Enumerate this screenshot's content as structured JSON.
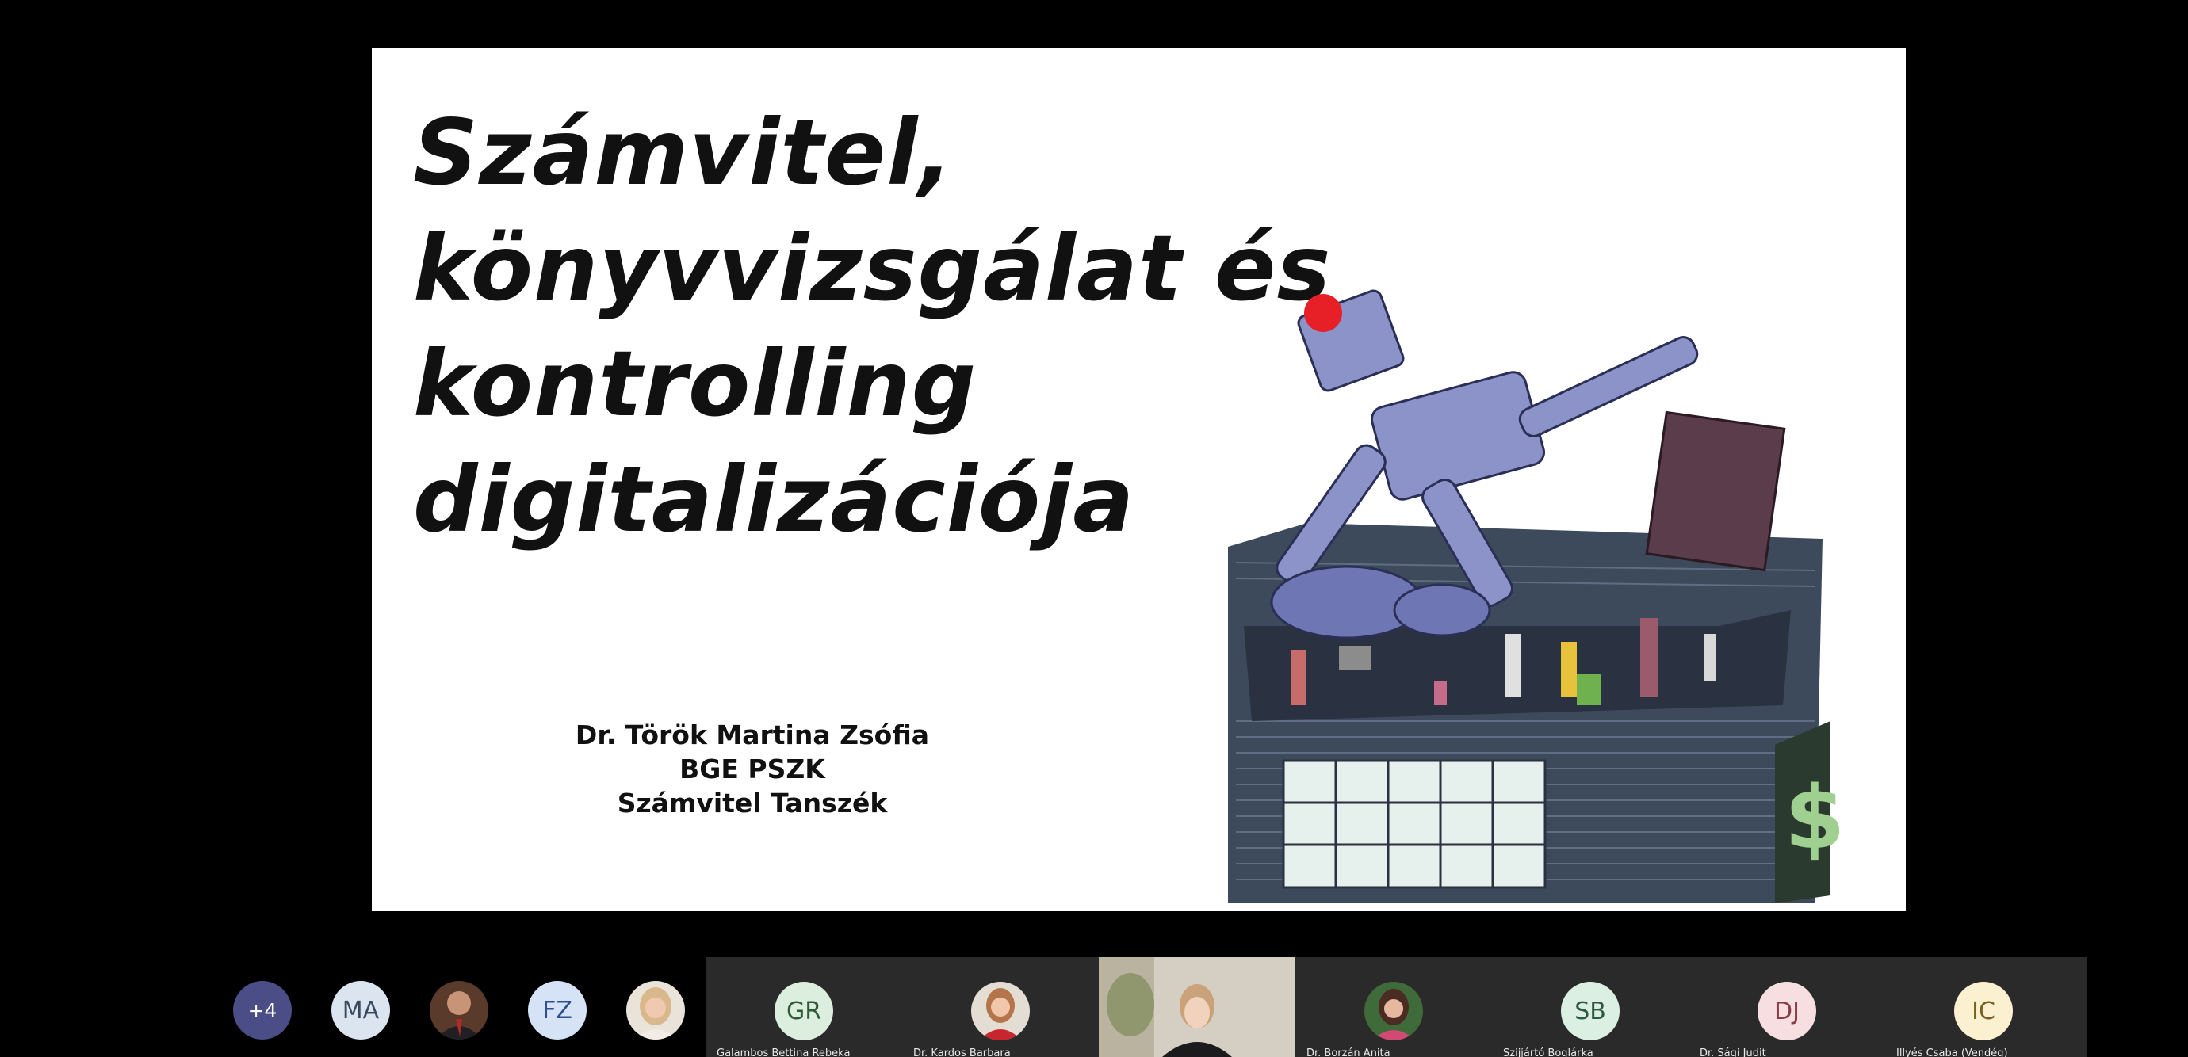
{
  "slide": {
    "title_lines": [
      "Számvitel,",
      "könyvvizsgálat és",
      "kontrolling",
      "digitalizációja"
    ],
    "presenter": {
      "name": "Dr. Török Martina Zsófia",
      "org": "BGE PSZK",
      "dept": "Számvitel Tanszék"
    },
    "illustration": "robot-office-illustration"
  },
  "participants": {
    "strip": [
      {
        "label": "+4",
        "bg": "#4b4d86",
        "fg": "#ffffff"
      },
      {
        "label": "MA",
        "bg": "#dbe5f0",
        "fg": "#3a4a5e"
      },
      {
        "label": "",
        "photo": "man-photo-avatar"
      },
      {
        "label": "FZ",
        "bg": "#d6e3f7",
        "fg": "#2f4f8f"
      },
      {
        "label": "",
        "photo": "woman-photo-avatar"
      }
    ],
    "tiles": [
      {
        "initials": "GR",
        "name": "Galambos Bettina Rebeka",
        "bg": "#dcefdf",
        "fg": "#2e5a36"
      },
      {
        "initials": "",
        "name": "Dr. Kardos Barbara",
        "photo": "woman-red-photo-avatar"
      },
      {
        "initials": "",
        "name": "",
        "video": "webcam-video-feed"
      },
      {
        "initials": "",
        "name": "Dr. Borzán Anita",
        "photo": "woman-dark-photo-avatar"
      },
      {
        "initials": "SB",
        "name": "Szijjártó Boglárka",
        "bg": "#dcefe3",
        "fg": "#2e5a40"
      },
      {
        "initials": "DJ",
        "name": "Dr. Sági Judit",
        "bg": "#f7dfe1",
        "fg": "#8a3a44"
      },
      {
        "initials": "IC",
        "name": "Illyés Csaba (Vendég)",
        "bg": "#fbf0cf",
        "fg": "#7a6020"
      }
    ]
  },
  "colors": {
    "background": "#000000",
    "slide_bg": "#ffffff",
    "tile_bg": "#2a2a2a"
  }
}
